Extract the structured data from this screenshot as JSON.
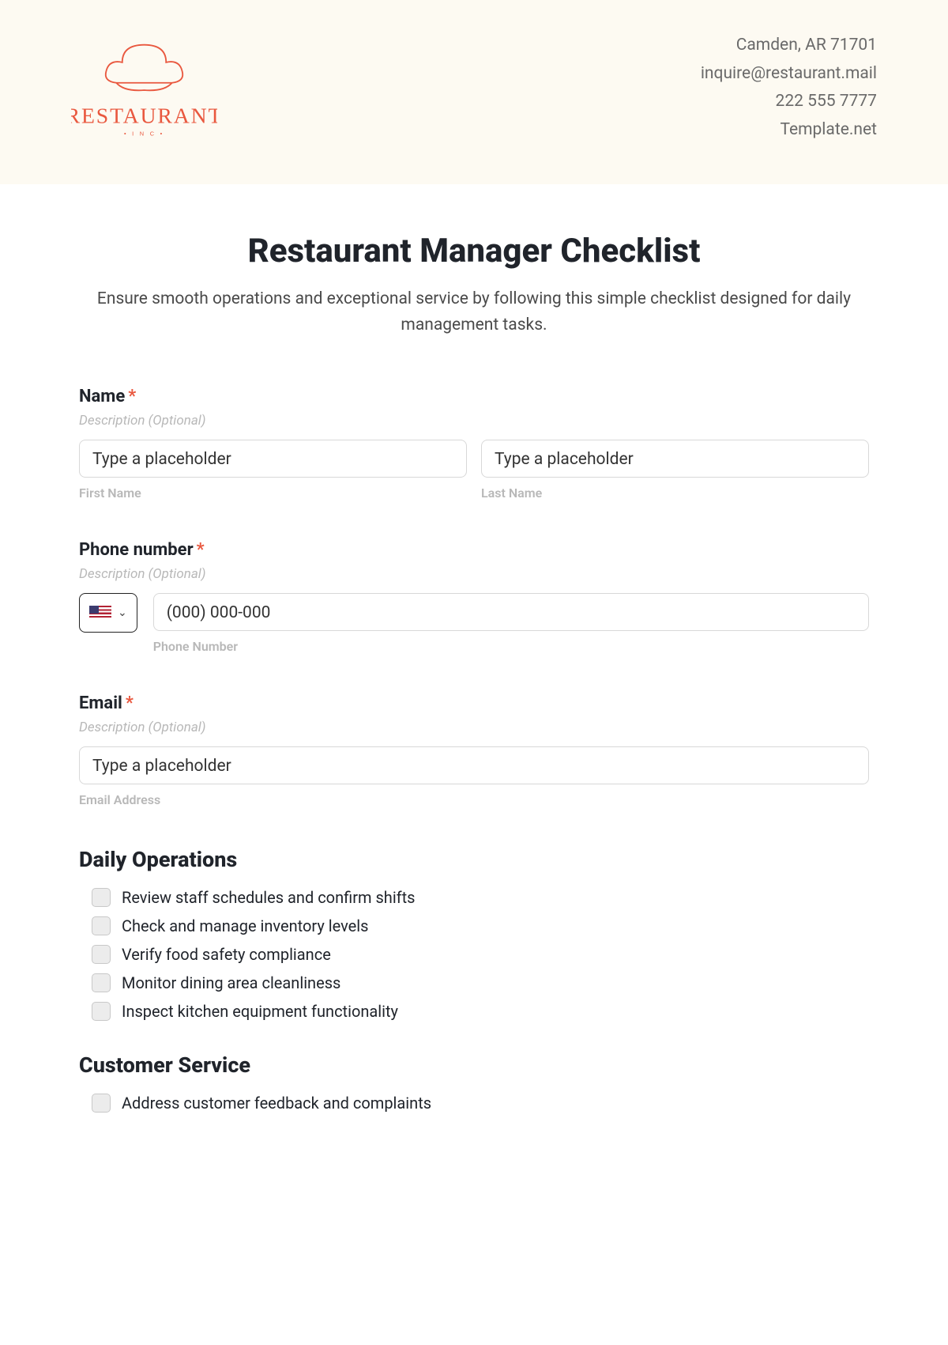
{
  "header": {
    "logo_main": "RESTAURANT",
    "logo_sub": "• I N C •",
    "contact": {
      "address": "Camden, AR 71701",
      "email": "inquire@restaurant.mail",
      "phone": "222 555 7777",
      "site": "Template.net"
    }
  },
  "title": "Restaurant Manager Checklist",
  "subtitle": "Ensure smooth operations and exceptional service by following this simple checklist designed for daily management tasks.",
  "fields": {
    "name": {
      "label": "Name",
      "desc": "Description (Optional)",
      "first_placeholder": "Type a placeholder",
      "last_placeholder": "Type a placeholder",
      "first_sub": "First Name",
      "last_sub": "Last Name"
    },
    "phone": {
      "label": "Phone number",
      "desc": "Description (Optional)",
      "placeholder": "(000) 000-000",
      "sub": "Phone Number"
    },
    "email": {
      "label": "Email",
      "desc": "Description (Optional)",
      "placeholder": "Type a placeholder",
      "sub": "Email Address"
    }
  },
  "sections": {
    "daily_ops": {
      "heading": "Daily Operations",
      "items": [
        "Review staff schedules and confirm shifts",
        "Check and manage inventory levels",
        "Verify food safety compliance",
        "Monitor dining area cleanliness",
        "Inspect kitchen equipment functionality"
      ]
    },
    "customer": {
      "heading": "Customer Service",
      "items": [
        "Address customer feedback and complaints"
      ]
    }
  }
}
